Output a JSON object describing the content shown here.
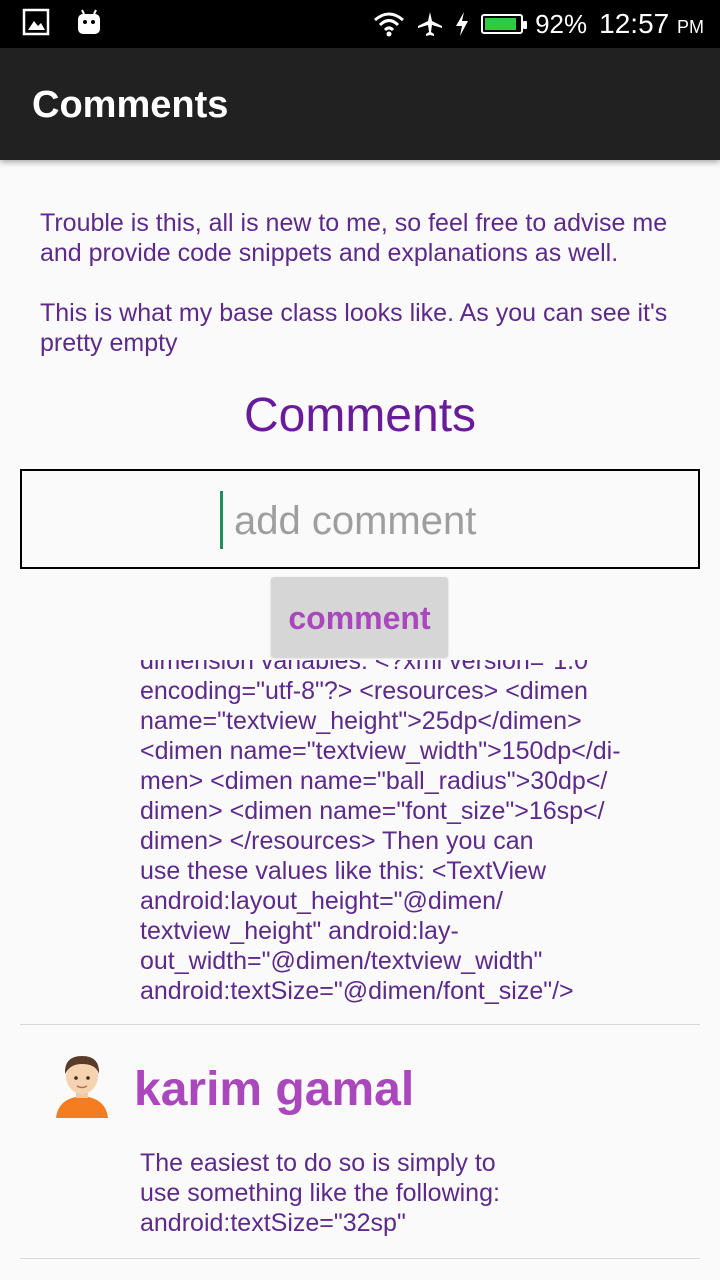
{
  "status_bar": {
    "battery_percent": "92%",
    "time": "12:57",
    "ampm": "PM",
    "battery_level": 0.92,
    "icons": [
      "gallery-icon",
      "android-icon",
      "wifi-icon",
      "airplane-mode-icon",
      "charging-icon",
      "battery-icon"
    ]
  },
  "app_bar": {
    "title": "Comments"
  },
  "post": {
    "paragraph_1": "Trouble is this, all is new to me, so feel free to advise me and provide code snippets and explanations as well.",
    "paragraph_2": "This is what my base class looks like. As you can see it's pretty empty"
  },
  "comments_section": {
    "title": "Comments",
    "input_placeholder": "add comment",
    "button_label": "comment"
  },
  "comments": [
    {
      "author": "",
      "text": "dimension variables:   <?xml version=\"1.0\"\nencoding=\"utf-8\"?> <resources>   <dimen\nname=\"textview_height\">25dp</dimen>\n<dimen name=\"textview_width\">150dp</di-\nmen>   <dimen name=\"ball_radius\">30dp</\ndimen>   <dimen name=\"font_size\">16sp</\ndimen> </resources> Then you can\nuse these values like this:  <TextView\nandroid:layout_height=\"@dimen/\ntextview_height\"    android:lay-\nout_width=\"@dimen/textview_width\"\nandroid:textSize=\"@dimen/font_size\"/>"
    },
    {
      "author": "karim gamal",
      "text": "The easiest to do so is simply to\nuse something like the following:\nandroid:textSize=\"32sp\""
    }
  ],
  "colors": {
    "accent": "#ab47bc",
    "text_purple": "#5d2a8c",
    "app_bar": "#212121",
    "caret": "#1e8e5a"
  }
}
